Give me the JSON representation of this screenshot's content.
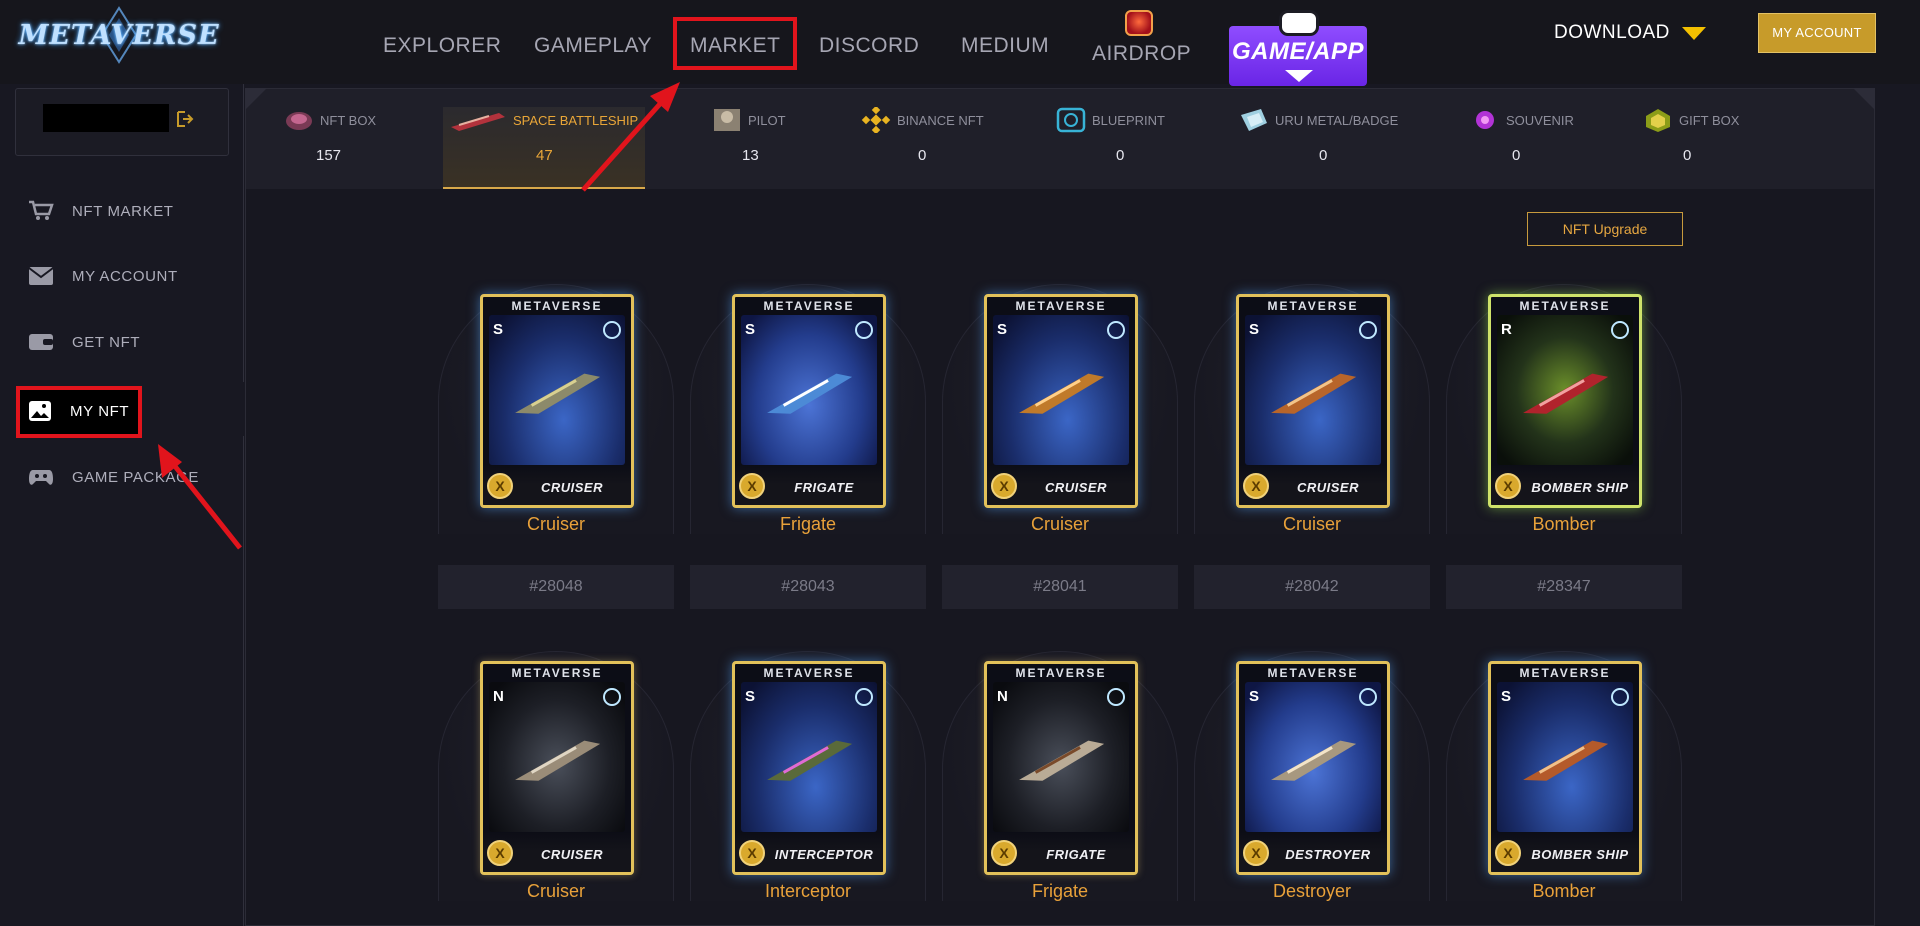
{
  "brand": {
    "logo_text": "METAVERSE"
  },
  "nav": {
    "items": [
      {
        "label": "EXPLORER"
      },
      {
        "label": "GAMEPLAY"
      },
      {
        "label": "MARKET"
      },
      {
        "label": "DISCORD"
      },
      {
        "label": "MEDIUM"
      },
      {
        "label": "AIRDROP"
      }
    ],
    "game_app_label": "GAME/APP",
    "download_label": "DOWNLOAD",
    "account_button": "MY ACCOUNT"
  },
  "sidebar": {
    "items": [
      {
        "label": "NFT MARKET",
        "icon": "cart-icon"
      },
      {
        "label": "MY ACCOUNT",
        "icon": "mail-icon"
      },
      {
        "label": "GET NFT",
        "icon": "wallet-icon"
      },
      {
        "label": "MY NFT",
        "icon": "image-icon"
      },
      {
        "label": "GAME PACKAGE",
        "icon": "gamepad-icon"
      }
    ]
  },
  "tabs": [
    {
      "label": "NFT BOX",
      "count": "157",
      "icon": "nft-box-icon"
    },
    {
      "label": "SPACE BATTLESHIP",
      "count": "47",
      "icon": "battleship-icon",
      "active": true
    },
    {
      "label": "PILOT",
      "count": "13",
      "icon": "pilot-icon"
    },
    {
      "label": "BINANCE NFT",
      "count": "0",
      "icon": "binance-icon"
    },
    {
      "label": "BLUEPRINT",
      "count": "0",
      "icon": "blueprint-icon"
    },
    {
      "label": "URU METAL/BADGE",
      "count": "0",
      "icon": "metal-icon"
    },
    {
      "label": "SOUVENIR",
      "count": "0",
      "icon": "souvenir-icon"
    },
    {
      "label": "GIFT BOX",
      "count": "0",
      "icon": "gift-icon"
    }
  ],
  "upgrade_button": "NFT Upgrade",
  "cards": [
    {
      "brand": "METAVERSE",
      "grade": "S",
      "type": "CRUISER",
      "name": "Cruiser",
      "id": "#28048"
    },
    {
      "brand": "METAVERSE",
      "grade": "S",
      "type": "FRIGATE",
      "name": "Frigate",
      "id": "#28043"
    },
    {
      "brand": "METAVERSE",
      "grade": "S",
      "type": "CRUISER",
      "name": "Cruiser",
      "id": "#28041"
    },
    {
      "brand": "METAVERSE",
      "grade": "S",
      "type": "CRUISER",
      "name": "Cruiser",
      "id": "#28042"
    },
    {
      "brand": "METAVERSE",
      "grade": "R",
      "type": "BOMBER SHIP",
      "name": "Bomber",
      "id": "#28347"
    },
    {
      "brand": "METAVERSE",
      "grade": "N",
      "type": "CRUISER",
      "name": "Cruiser"
    },
    {
      "brand": "METAVERSE",
      "grade": "S",
      "type": "INTERCEPTOR",
      "name": "Interceptor"
    },
    {
      "brand": "METAVERSE",
      "grade": "N",
      "type": "FRIGATE",
      "name": "Frigate"
    },
    {
      "brand": "METAVERSE",
      "grade": "S",
      "type": "DESTROYER",
      "name": "Destroyer"
    },
    {
      "brand": "METAVERSE",
      "grade": "S",
      "type": "BOMBER SHIP",
      "name": "Bomber"
    }
  ],
  "colors": {
    "accent": "#e8a13a",
    "highlight": "#e1141c",
    "button_gold": "#c79b2a",
    "game_app_purple": "#7b35f0"
  }
}
